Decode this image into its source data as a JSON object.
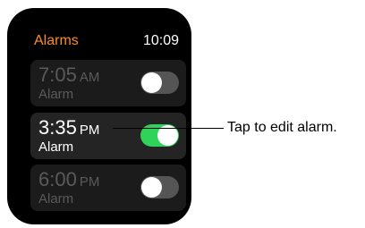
{
  "app_title": "Alarms",
  "clock": "10:09",
  "alarms": [
    {
      "time": "7:05",
      "ampm": "AM",
      "label": "Alarm",
      "enabled": false
    },
    {
      "time": "3:35",
      "ampm": "PM",
      "label": "Alarm",
      "enabled": true
    },
    {
      "time": "6:00",
      "ampm": "PM",
      "label": "Alarm",
      "enabled": false
    }
  ],
  "callout": "Tap to edit alarm.",
  "colors": {
    "accent": "#ff8c1a",
    "toggle_on": "#2fd35a",
    "toggle_off": "#555555"
  }
}
